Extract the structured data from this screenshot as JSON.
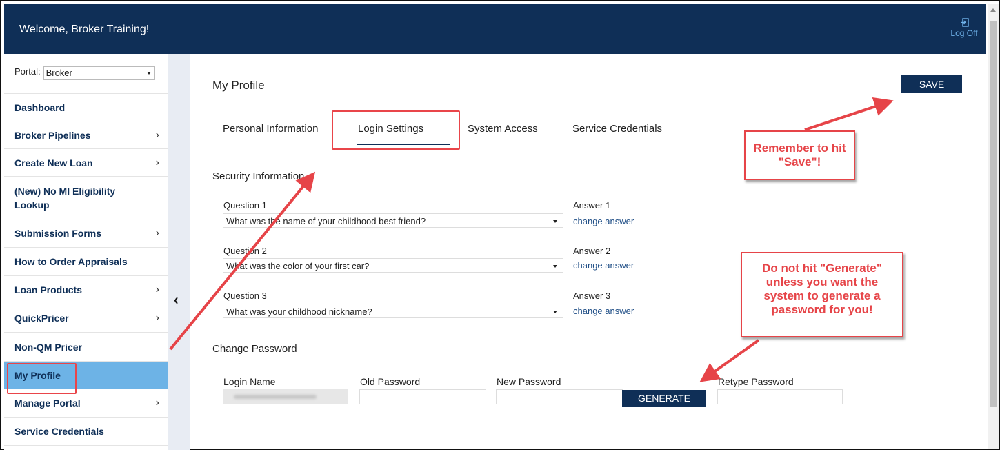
{
  "header": {
    "welcome": "Welcome, Broker Training!",
    "logoff_label": "Log Off",
    "logoff_icon": "logoff-icon"
  },
  "sidebar": {
    "portal_label": "Portal:",
    "portal_value": "Broker",
    "items": [
      {
        "label": "Dashboard",
        "has_chevron": false
      },
      {
        "label": "Broker Pipelines",
        "has_chevron": true
      },
      {
        "label": "Create New Loan",
        "has_chevron": true
      },
      {
        "label": "(New) No MI Eligibility Lookup",
        "has_chevron": false
      },
      {
        "label": "Submission Forms",
        "has_chevron": true
      },
      {
        "label": "How to Order Appraisals",
        "has_chevron": false
      },
      {
        "label": "Loan Products",
        "has_chevron": true
      },
      {
        "label": "QuickPricer",
        "has_chevron": true
      },
      {
        "label": "Non-QM Pricer",
        "has_chevron": false
      },
      {
        "label": "My Profile",
        "has_chevron": false,
        "active": true
      },
      {
        "label": "Manage Portal",
        "has_chevron": true
      },
      {
        "label": "Service Credentials",
        "has_chevron": false
      }
    ],
    "chevron_glyph": "›",
    "collapse_glyph": "‹"
  },
  "main": {
    "title": "My Profile",
    "save_label": "SAVE",
    "tabs": [
      "Personal Information",
      "Login Settings",
      "System Access",
      "Service Credentials"
    ],
    "active_tab": "Login Settings",
    "security": {
      "title": "Security Information",
      "questions": [
        {
          "label": "Question 1",
          "value": "What was the name of your childhood best friend?",
          "answer_label": "Answer 1",
          "answer_link": "change answer"
        },
        {
          "label": "Question 2",
          "value": "What was the color of your first car?",
          "answer_label": "Answer 2",
          "answer_link": "change answer"
        },
        {
          "label": "Question 3",
          "value": "What was your childhood nickname?",
          "answer_label": "Answer 3",
          "answer_link": "change answer"
        }
      ]
    },
    "password": {
      "title": "Change Password",
      "login_name_label": "Login Name",
      "old_password_label": "Old Password",
      "new_password_label": "New Password",
      "generate_label": "GENERATE",
      "retype_password_label": "Retype Password"
    }
  },
  "annotations": {
    "callout_save": "Remember to hit \"Save\"!",
    "callout_generate": "Do not hit \"Generate\" unless you want the system to generate a password for you!",
    "highlight_color": "#e9454a"
  },
  "colors": {
    "brand_navy": "#0f2f57",
    "active_nav": "#6db3e6",
    "link": "#1f4e86",
    "callout_red": "#e64448"
  }
}
